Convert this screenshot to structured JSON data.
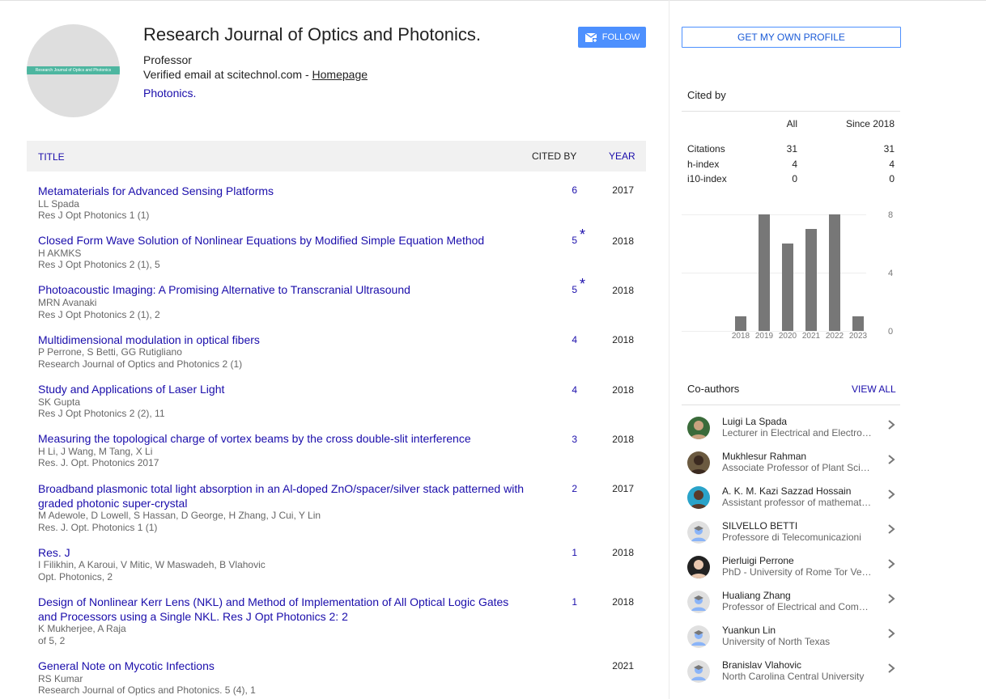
{
  "profile": {
    "avatar_text": "Research Journal of Optics and Photonics",
    "name": "Research Journal of Optics and Photonics.",
    "role": "Professor",
    "email_text": "Verified email at scitechnol.com - ",
    "homepage_label": "Homepage",
    "interest": "Photonics."
  },
  "actions": {
    "follow_label": "FOLLOW",
    "own_profile_label": "GET MY OWN PROFILE"
  },
  "table": {
    "header": {
      "title": "TITLE",
      "cited_by": "CITED BY",
      "year": "YEAR"
    },
    "rows": [
      {
        "title": "Metamaterials for Advanced Sensing Platforms",
        "authors": "LL Spada",
        "venue": "Res J Opt Photonics 1 (1)",
        "cited": "6",
        "star": "",
        "year": "2017"
      },
      {
        "title": "Closed Form Wave Solution of Nonlinear Equations by Modified Simple Equation Method",
        "authors": "H AKMKS",
        "venue": "Res J Opt Photonics 2 (1), 5",
        "cited": "5",
        "star": "*",
        "year": "2018"
      },
      {
        "title": "Photoacoustic Imaging: A Promising Alternative to Transcranial Ultrasound",
        "authors": "MRN Avanaki",
        "venue": "Res J Opt Photonics 2 (1), 2",
        "cited": "5",
        "star": "*",
        "year": "2018"
      },
      {
        "title": "Multidimensional modulation in optical fibers",
        "authors": "P Perrone, S Betti, GG Rutigliano",
        "venue": "Research Journal of Optics and Photonics 2 (1)",
        "cited": "4",
        "star": "",
        "year": "2018"
      },
      {
        "title": "Study and Applications of Laser Light",
        "authors": "SK Gupta",
        "venue": "Res J Opt Photonics 2 (2), 11",
        "cited": "4",
        "star": "",
        "year": "2018"
      },
      {
        "title": "Measuring the topological charge of vortex beams by the cross double-slit interference",
        "authors": "H Li, J Wang, M Tang, X Li",
        "venue": "Res. J. Opt. Photonics 2017",
        "cited": "3",
        "star": "",
        "year": "2018"
      },
      {
        "title": "Broadband plasmonic total light absorption in an Al-doped ZnO/spacer/silver stack patterned with graded photonic super-crystal",
        "authors": "M Adewole, D Lowell, S Hassan, D George, H Zhang, J Cui, Y Lin",
        "venue": "Res. J. Opt. Photonics 1 (1)",
        "cited": "2",
        "star": "",
        "year": "2017"
      },
      {
        "title": "Res. J",
        "authors": "I Filikhin, A Karoui, V Mitic, W Maswadeh, B Vlahovic",
        "venue": "Opt. Photonics, 2",
        "cited": "1",
        "star": "",
        "year": "2018"
      },
      {
        "title": "Design of Nonlinear Kerr Lens (NKL) and Method of Implementation of All Optical Logic Gates and Processors using a Single NKL. Res J Opt Photonics 2: 2",
        "authors": "K Mukherjee, A Raja",
        "venue": "of 5, 2",
        "cited": "1",
        "star": "",
        "year": "2018"
      },
      {
        "title": "General Note on Mycotic Infections",
        "authors": "RS Kumar",
        "venue": "Research Journal of Optics and Photonics. 5 (4), 1",
        "cited": "",
        "star": "",
        "year": "2021"
      }
    ]
  },
  "cited_by": {
    "heading": "Cited by",
    "col_all": "All",
    "col_since": "Since 2018",
    "metrics": [
      {
        "label": "Citations",
        "all": "31",
        "since": "31"
      },
      {
        "label": "h-index",
        "all": "4",
        "since": "4"
      },
      {
        "label": "i10-index",
        "all": "0",
        "since": "0"
      }
    ]
  },
  "chart_data": {
    "type": "bar",
    "categories": [
      "2018",
      "2019",
      "2020",
      "2021",
      "2022",
      "2023"
    ],
    "values": [
      1,
      8,
      6,
      7,
      8,
      1
    ],
    "yticks": [
      "8",
      "4",
      "0"
    ],
    "ylim": [
      0,
      8
    ],
    "grid": true,
    "bar_color": "#777777"
  },
  "coauthors": {
    "heading": "Co-authors",
    "view_all": "VIEW ALL",
    "items": [
      {
        "name": "Luigi La Spada",
        "affiliation": "Lecturer in Electrical and Electronic Engineering",
        "avatar": "photo"
      },
      {
        "name": "Mukhlesur Rahman",
        "affiliation": "Associate Professor of Plant Sciences",
        "avatar": "photo"
      },
      {
        "name": "A. K. M. Kazi Sazzad Hossain",
        "affiliation": "Assistant professor of mathematics",
        "avatar": "photo"
      },
      {
        "name": "SILVELLO BETTI",
        "affiliation": "Professore di Telecomunicazioni",
        "avatar": "default"
      },
      {
        "name": "Pierluigi Perrone",
        "affiliation": "PhD - University of Rome Tor Vergata",
        "avatar": "photo"
      },
      {
        "name": "Hualiang Zhang",
        "affiliation": "Professor of Electrical and Computer Engineering",
        "avatar": "default"
      },
      {
        "name": "Yuankun Lin",
        "affiliation": "University of North Texas",
        "avatar": "default"
      },
      {
        "name": "Branislav Vlahovic",
        "affiliation": "North Carolina Central University",
        "avatar": "default"
      }
    ]
  },
  "colors": {
    "link": "#1a0dab",
    "accent": "#4d90fe",
    "avatar_band": "#4db6a0"
  }
}
